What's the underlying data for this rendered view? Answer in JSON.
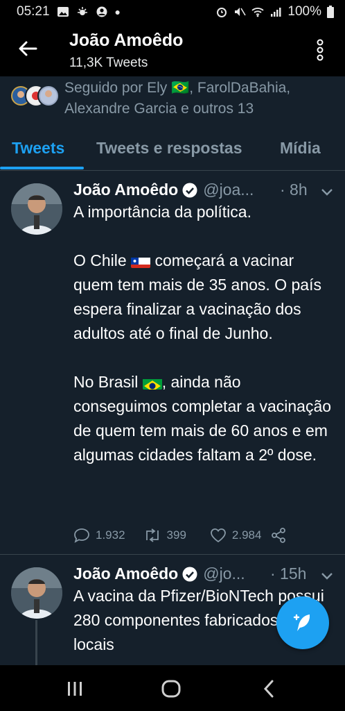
{
  "status_bar": {
    "time": "05:21",
    "battery": "100%"
  },
  "header": {
    "title": "João Amoêdo",
    "subtitle": "11,3K Tweets"
  },
  "followed_by": {
    "text": "Seguido por Ely 🇧🇷, FarolDaBahia, Alexandre Garcia e outros 13"
  },
  "tabs": [
    {
      "label": "Tweets"
    },
    {
      "label": "Tweets e respostas"
    },
    {
      "label": "Mídia"
    }
  ],
  "tweets": [
    {
      "name": "João Amoêdo",
      "handle": "@joa...",
      "time": "· 8h",
      "lines": [
        "A importância da política.",
        "",
        "O Chile",
        "começará a vacinar quem tem mais de 35 anos. O país espera finalizar a vacinação dos adultos até o final de Junho.",
        "No Brasil",
        ", ainda não conseguimos completar a vacinação de quem tem mais de 60 anos e em algumas cidades faltam a 2º dose."
      ],
      "replies": "1.932",
      "retweets": "399",
      "likes": "2.984"
    },
    {
      "name": "João Amoêdo",
      "handle": "@jo...",
      "time": "· 15h",
      "text": "A vacina da Pfizer/BioNTech possui 280 componentes fabricados em 86 locais"
    }
  ],
  "colors": {
    "background": "#15202b",
    "accent": "#1da1f2",
    "muted": "#8899a6"
  }
}
